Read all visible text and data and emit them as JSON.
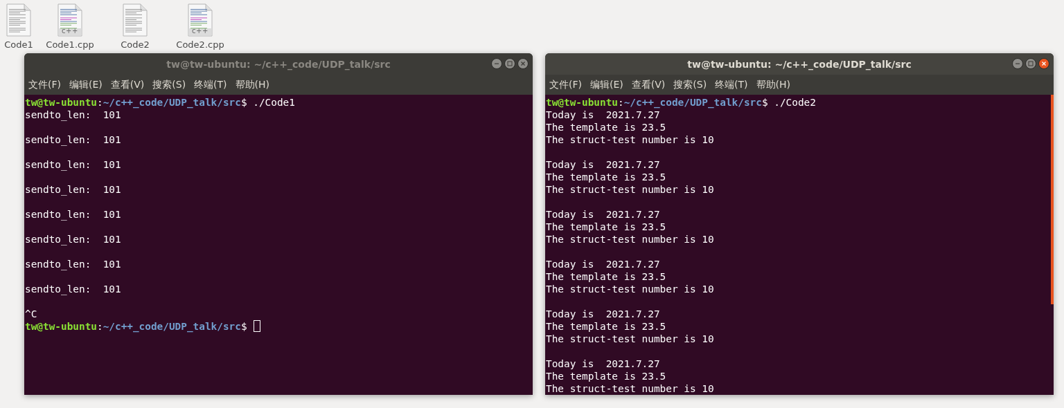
{
  "desktop_icons": [
    {
      "label": "Code1",
      "kind": "text"
    },
    {
      "label": "Code1.cpp",
      "kind": "cpp",
      "badge": "c++"
    },
    {
      "label": "Code2",
      "kind": "text"
    },
    {
      "label": "Code2.cpp",
      "kind": "cpp",
      "badge": "c++"
    }
  ],
  "windows": [
    {
      "title": "tw@tw-ubuntu: ~/c++_code/UDP_talk/src",
      "active": false,
      "scrollbar": false,
      "menu": [
        "文件(F)",
        "编辑(E)",
        "查看(V)",
        "搜索(S)",
        "终端(T)",
        "帮助(H)"
      ],
      "lines": [
        {
          "kind": "prompt",
          "user": "tw@tw-ubuntu",
          "sep": ":",
          "path": "~/c++_code/UDP_talk/src",
          "dollar": "$",
          "command": " ./Code1"
        },
        {
          "kind": "output",
          "text": "sendto_len:  101"
        },
        {
          "kind": "blank"
        },
        {
          "kind": "output",
          "text": "sendto_len:  101"
        },
        {
          "kind": "blank"
        },
        {
          "kind": "output",
          "text": "sendto_len:  101"
        },
        {
          "kind": "blank"
        },
        {
          "kind": "output",
          "text": "sendto_len:  101"
        },
        {
          "kind": "blank"
        },
        {
          "kind": "output",
          "text": "sendto_len:  101"
        },
        {
          "kind": "blank"
        },
        {
          "kind": "output",
          "text": "sendto_len:  101"
        },
        {
          "kind": "blank"
        },
        {
          "kind": "output",
          "text": "sendto_len:  101"
        },
        {
          "kind": "blank"
        },
        {
          "kind": "output",
          "text": "sendto_len:  101"
        },
        {
          "kind": "blank"
        },
        {
          "kind": "output",
          "text": "^C"
        },
        {
          "kind": "prompt",
          "user": "tw@tw-ubuntu",
          "sep": ":",
          "path": "~/c++_code/UDP_talk/src",
          "dollar": "$",
          "cursor": true
        }
      ]
    },
    {
      "title": "tw@tw-ubuntu: ~/c++_code/UDP_talk/src",
      "active": true,
      "scrollbar": true,
      "menu": [
        "文件(F)",
        "编辑(E)",
        "查看(V)",
        "搜索(S)",
        "终端(T)",
        "帮助(H)"
      ],
      "lines": [
        {
          "kind": "prompt",
          "user": "tw@tw-ubuntu",
          "sep": ":",
          "path": "~/c++_code/UDP_talk/src",
          "dollar": "$",
          "command": " ./Code2"
        },
        {
          "kind": "output",
          "text": "Today is  2021.7.27"
        },
        {
          "kind": "output",
          "text": "The template is 23.5"
        },
        {
          "kind": "output",
          "text": "The struct-test number is 10"
        },
        {
          "kind": "blank"
        },
        {
          "kind": "output",
          "text": "Today is  2021.7.27"
        },
        {
          "kind": "output",
          "text": "The template is 23.5"
        },
        {
          "kind": "output",
          "text": "The struct-test number is 10"
        },
        {
          "kind": "blank"
        },
        {
          "kind": "output",
          "text": "Today is  2021.7.27"
        },
        {
          "kind": "output",
          "text": "The template is 23.5"
        },
        {
          "kind": "output",
          "text": "The struct-test number is 10"
        },
        {
          "kind": "blank"
        },
        {
          "kind": "output",
          "text": "Today is  2021.7.27"
        },
        {
          "kind": "output",
          "text": "The template is 23.5"
        },
        {
          "kind": "output",
          "text": "The struct-test number is 10"
        },
        {
          "kind": "blank"
        },
        {
          "kind": "output",
          "text": "Today is  2021.7.27"
        },
        {
          "kind": "output",
          "text": "The template is 23.5"
        },
        {
          "kind": "output",
          "text": "The struct-test number is 10"
        },
        {
          "kind": "blank"
        },
        {
          "kind": "output",
          "text": "Today is  2021.7.27"
        },
        {
          "kind": "output",
          "text": "The template is 23.5"
        },
        {
          "kind": "output",
          "text": "The struct-test number is 10"
        }
      ]
    }
  ]
}
